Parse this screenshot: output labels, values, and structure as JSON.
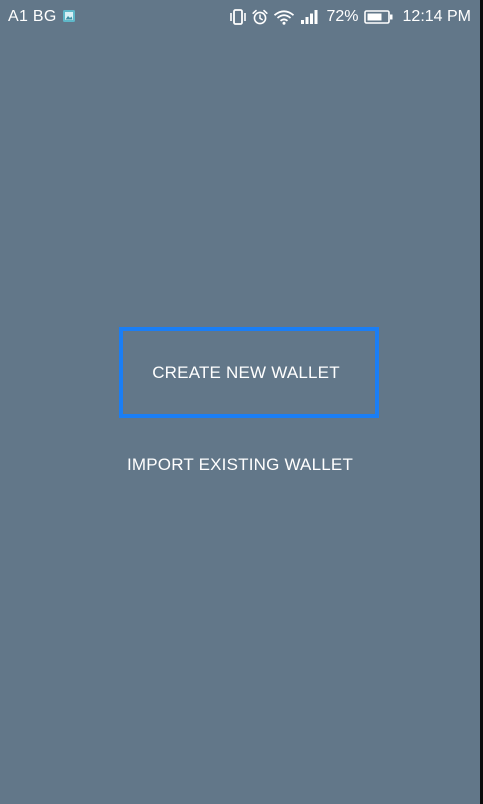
{
  "status_bar": {
    "carrier": "A1 BG",
    "notification_icon": "gallery-icon",
    "icons": [
      "vibrate-icon",
      "alarm-icon",
      "wifi-icon",
      "signal-icon"
    ],
    "battery_percent": "72%",
    "time": "12:14 PM"
  },
  "main": {
    "create_label": "CREATE NEW WALLET",
    "import_label": "IMPORT EXISTING WALLET"
  },
  "colors": {
    "background": "#627789",
    "highlight_border": "#1a7ef5",
    "text": "#ffffff"
  }
}
